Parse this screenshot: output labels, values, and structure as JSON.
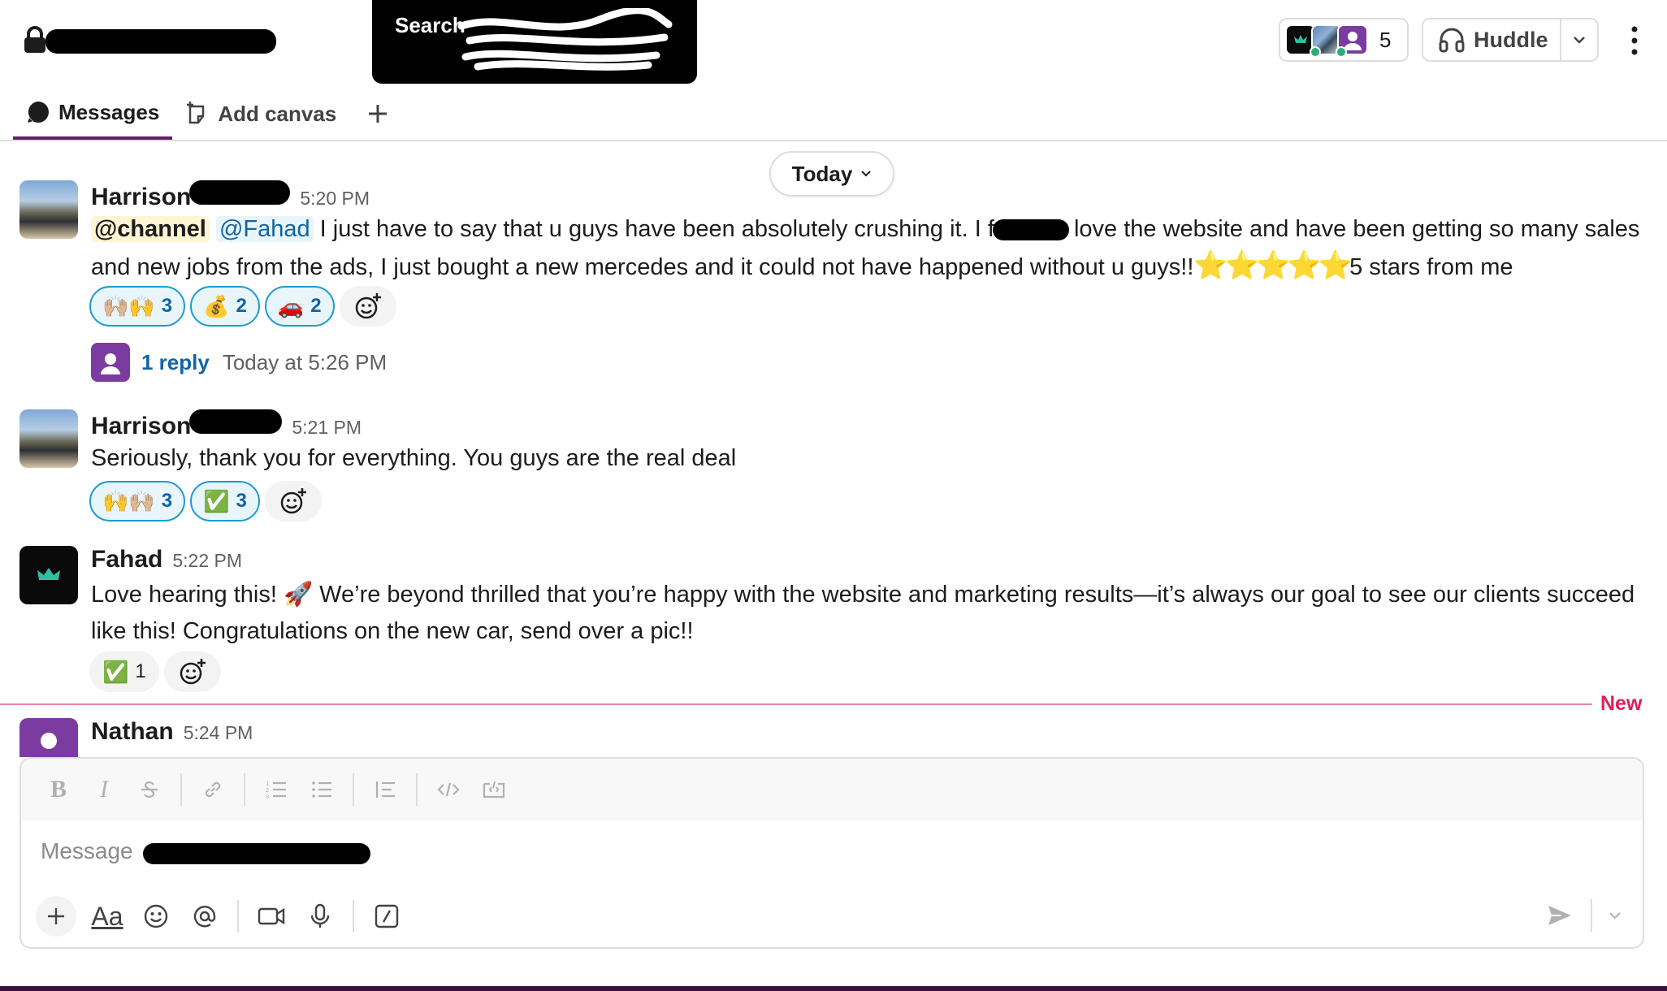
{
  "header": {
    "search_label": "Search",
    "members_count": "5",
    "huddle_label": "Huddle"
  },
  "tabs": [
    {
      "label": "Messages"
    },
    {
      "label": "Add canvas"
    }
  ],
  "date_divider": "Today",
  "messages": [
    {
      "author": "Harrison",
      "time": "5:20 PM",
      "mention_channel": "@channel",
      "mention_user": "@Fahad",
      "text_a": "I just have to say that u guys have been absolutely crushing it. I f",
      "text_b": " love the website and have been getting so many sales and new jobs from the ads, I just bought a new mercedes and it could not have happened without u guys!!",
      "stars": "⭐⭐⭐⭐⭐",
      "text_c": "5 stars from me",
      "reactions": [
        {
          "emoji": "🙌🏼🙌",
          "count": "3"
        },
        {
          "emoji": "💰",
          "count": "2"
        },
        {
          "emoji": "🚗",
          "count": "2"
        }
      ],
      "thread": {
        "reply_count": "1 reply",
        "reply_time": "Today at 5:26 PM"
      }
    },
    {
      "author": "Harrison",
      "time": "5:21 PM",
      "text": "Seriously, thank you for everything. You guys are the real deal",
      "reactions": [
        {
          "emoji": "🙌🙌🏼",
          "count": "3"
        },
        {
          "emoji": "✅",
          "count": "3"
        }
      ]
    },
    {
      "author": "Fahad",
      "time": "5:22 PM",
      "text_a": "Love hearing this! ",
      "rocket": "🚀",
      "text_b": " We’re beyond thrilled that you’re happy with the website and marketing results—it’s always our goal to see our clients succeed like this! Congratulations on the new car, send over a pic!!",
      "reactions": [
        {
          "emoji": "✅",
          "count": "1"
        }
      ]
    },
    {
      "author": "Nathan",
      "time": "5:24 PM"
    }
  ],
  "new_divider_label": "New",
  "composer": {
    "placeholder": "Message",
    "aa_label": "Aa"
  },
  "colors": {
    "brand_purple": "#611f69",
    "link_blue": "#1264a3",
    "reaction_border": "#1d9bd1",
    "new_red": "#e01e5a",
    "nathan_purple": "#7b3ba0"
  }
}
